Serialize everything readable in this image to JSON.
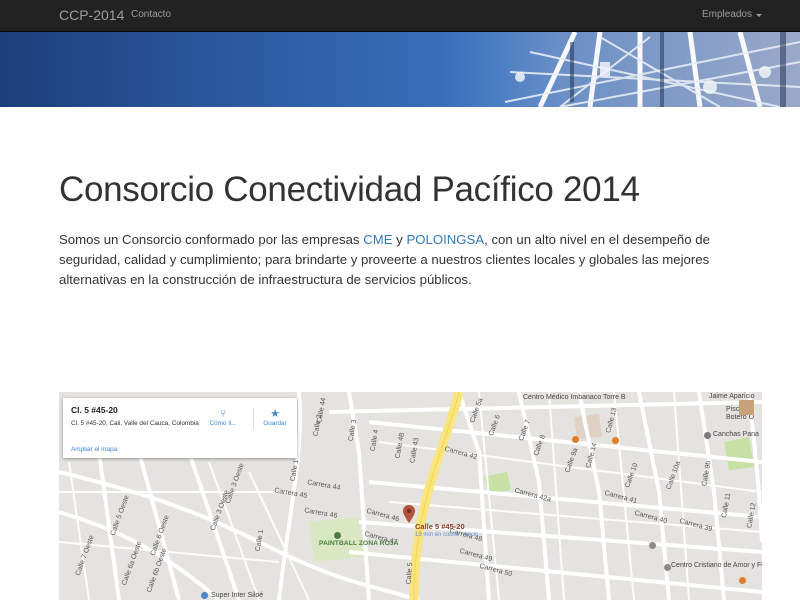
{
  "navbar": {
    "brand": "CCP-2014",
    "links": [
      "Contacto"
    ],
    "dropdown_label": "Empleados"
  },
  "header": {
    "title": "Consorcio Conectividad Pacífico 2014"
  },
  "intro": {
    "text_1": "Somos un Consorcio conformado por las empresas ",
    "link_cme": "CME",
    "text_2": " y ",
    "link_poloingsa": "POLOINGSA",
    "text_3": ", con un alto nivel en el desempeño de seguridad, calidad y cumplimiento; para brindarte y proveerte a nuestros clientes locales y globales las mejores alternativas en la construcción de infraestructura de servicios públicos."
  },
  "map": {
    "card": {
      "title": "Cl. 5 #45-20",
      "address": "Cl. 5 #45-20, Cali, Valle del Cauca, Colombia",
      "directions_label": "Cómo ll...",
      "save_label": "Guardar",
      "enlarge_label": "Ampliar el mapa"
    },
    "marker": {
      "title": "Calle 5 #45-20",
      "subtitle": "13 min en coche · Inicio"
    },
    "places": {
      "centro_medico": "Centro Médico Imbanaco Torre B",
      "jaime": "Jaime Aparicio",
      "pisci": "Pisci",
      "botero": "Botero O",
      "canchas": "Canchas Pana",
      "paintball": "PAINTBALL ZONA ROJA",
      "centro_cristiano": "Centro Cristiano de Amor y Fe",
      "super_inter": "Super Inter Siloé"
    },
    "streets": {
      "calle_3_oeste_a": "Calle 3 Oeste",
      "calle_3_oeste_b": "Calle 3 Oeste",
      "calle_5_oeste": "Calle 5 Oeste",
      "calle_6_oeste": "Calle 6 Oeste",
      "calle_6a_oeste": "Calle 6a Oeste",
      "calle_6b_oeste": "Calle 6b Oeste",
      "calle_7_oeste": "Calle 7 Oeste",
      "calle_1": "Calle 1",
      "calle_1b": "Calle 1",
      "calle_2": "Calle 2",
      "calle_3": "Calle 3",
      "calle_4": "Calle 4",
      "calle_4b": "Calle 4B",
      "calle_5": "Calle 5",
      "calle_5a": "Calle 5a",
      "calle_6": "Calle 6",
      "calle_7": "Calle 7",
      "calle_8": "Calle 8",
      "calle_9a": "Calle 9a",
      "calle_9b": "Calle 9b",
      "calle_10": "Calle 10",
      "calle_10a": "Calle 10a",
      "calle_11": "Calle 11",
      "calle_12": "Calle 12",
      "calle_13": "Calle 13",
      "calle_14": "Calle 14",
      "calle_44": "Calle 44",
      "calle_43": "Calle 43",
      "carrera_42": "Carrera 42",
      "carrera_42a": "Carrera 42a",
      "carrera_41": "Carrera 41",
      "carrera_40": "Carrera 40",
      "carrera_39": "Carrera 39",
      "carrera_44": "Carrera 44",
      "carrera_45": "Carrera 45",
      "carrera_46": "Carrera 46",
      "carrera_46b": "Carrera 46",
      "carrera_47": "Carrera 47",
      "carrera_48": "Carrera 48",
      "carrera_49": "Carrera 49",
      "carrera_50": "Carrera 50"
    },
    "colors": {
      "background": "#e5e3df",
      "road": "#ffffff",
      "arterial": "#f9e57a",
      "park": "#c7e0a3",
      "marker": "#b5523b"
    }
  },
  "icons": {
    "directions": "directions-icon",
    "save": "star-icon",
    "marker": "map-pin-icon",
    "caret": "caret-down-icon"
  }
}
